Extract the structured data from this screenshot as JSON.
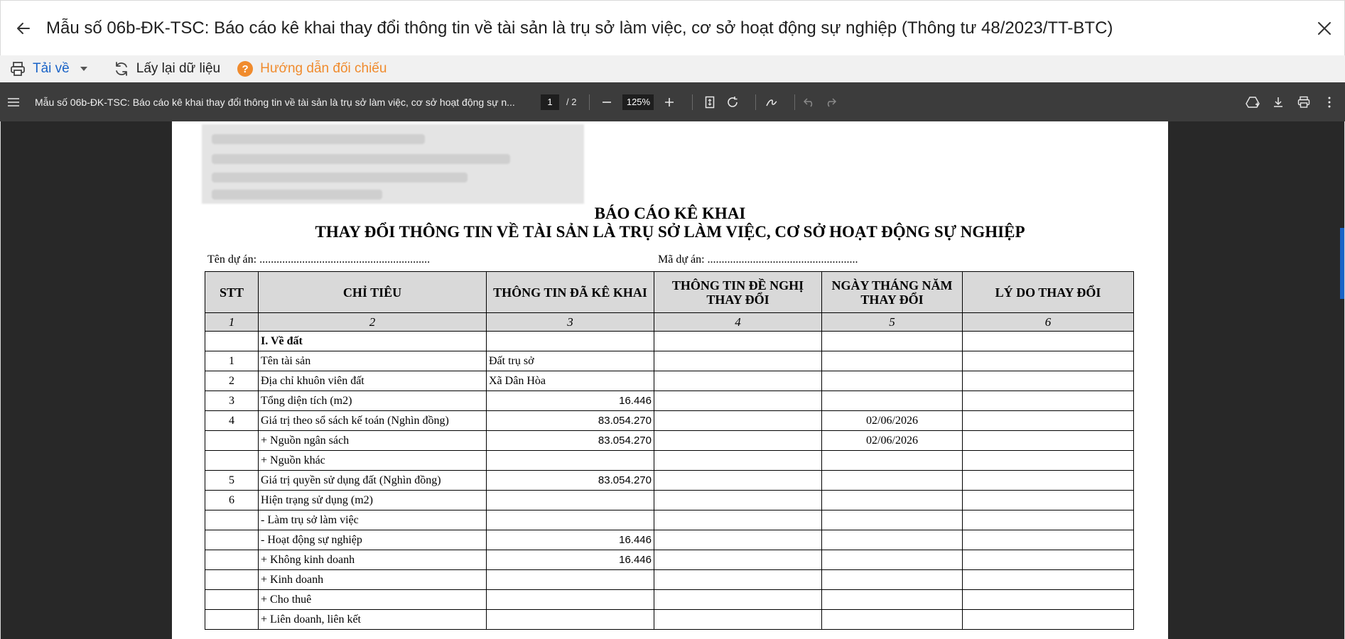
{
  "window": {
    "title": "Mẫu số 06b-ĐK-TSC: Báo cáo kê khai thay đổi thông tin về tài sản là trụ sở làm việc, cơ sở hoạt động sự nghiệp (Thông tư 48/2023/TT-BTC)"
  },
  "actions": {
    "download_label": "Tải về",
    "reload_label": "Lấy lại dữ liệu",
    "guide_label": "Hướng dẫn đối chiếu"
  },
  "pdf_toolbar": {
    "doc_title": "Mẫu số 06b-ĐK-TSC: Báo cáo kê khai thay đổi thông tin về tài sản là trụ sở làm việc, cơ sở hoạt động sự n...",
    "current_page": "1",
    "page_total": "/  2",
    "zoom": "125%"
  },
  "report": {
    "title_line1": "BÁO CÁO KÊ KHAI",
    "title_line2": "THAY ĐỔI THÔNG TIN VỀ TÀI SẢN LÀ TRỤ SỞ LÀM VIỆC, CƠ SỞ HOẠT ĐỘNG SỰ NGHIỆP",
    "project_name_field": "Tên dự án: ............................................................",
    "project_code_field": "Mã dự án: .....................................................",
    "headers": [
      "STT",
      "CHỈ TIÊU",
      "THÔNG TIN ĐÃ KÊ KHAI",
      "THÔNG TIN ĐỀ NGHỊ THAY ĐỔI",
      "NGÀY THÁNG NĂM THAY ĐỔI",
      "LÝ DO THAY ĐỔI"
    ],
    "column_numbers": [
      "1",
      "2",
      "3",
      "4",
      "5",
      "6"
    ],
    "rows": [
      {
        "stt": "",
        "label": "I. Về đất",
        "declared": "",
        "proposed": "",
        "date": "",
        "reason": ""
      },
      {
        "stt": "1",
        "label": "Tên tài sản",
        "declared": "Đất trụ sở",
        "proposed": "",
        "date": "",
        "reason": ""
      },
      {
        "stt": "2",
        "label": "Địa chỉ khuôn viên đất",
        "declared": "Xã Dân Hòa",
        "proposed": "",
        "date": "",
        "reason": ""
      },
      {
        "stt": "3",
        "label": "Tổng diện tích (m2)",
        "declared": "16.446",
        "proposed": "",
        "date": "",
        "reason": ""
      },
      {
        "stt": "4",
        "label": "Giá trị theo sổ sách kế toán (Nghìn đồng)",
        "declared": "83.054.270",
        "proposed": "",
        "date": "02/06/2026",
        "reason": ""
      },
      {
        "stt": "",
        "label": "+ Nguồn ngân sách",
        "declared": "83.054.270",
        "proposed": "",
        "date": "02/06/2026",
        "reason": ""
      },
      {
        "stt": "",
        "label": "+ Nguồn khác",
        "declared": "",
        "proposed": "",
        "date": "",
        "reason": ""
      },
      {
        "stt": "5",
        "label": "Giá trị quyền sử dụng đất (Nghìn đồng)",
        "declared": "83.054.270",
        "proposed": "",
        "date": "",
        "reason": ""
      },
      {
        "stt": "6",
        "label": "Hiện trạng sử dụng (m2)",
        "declared": "",
        "proposed": "",
        "date": "",
        "reason": ""
      },
      {
        "stt": "",
        "label": "- Làm trụ sở làm việc",
        "declared": "",
        "proposed": "",
        "date": "",
        "reason": ""
      },
      {
        "stt": "",
        "label": "- Hoạt động sự nghiệp",
        "declared": "16.446",
        "proposed": "",
        "date": "",
        "reason": ""
      },
      {
        "stt": "",
        "label": "+ Không kinh doanh",
        "declared": "16.446",
        "proposed": "",
        "date": "",
        "reason": ""
      },
      {
        "stt": "",
        "label": "+ Kinh doanh",
        "declared": "",
        "proposed": "",
        "date": "",
        "reason": ""
      },
      {
        "stt": "",
        "label": "+ Cho thuê",
        "declared": "",
        "proposed": "",
        "date": "",
        "reason": ""
      },
      {
        "stt": "",
        "label": "+ Liên doanh, liên kết",
        "declared": "",
        "proposed": "",
        "date": "",
        "reason": ""
      }
    ]
  },
  "icons": {
    "back": "arrow-left-icon",
    "close": "close-icon",
    "printer": "printer-icon",
    "reload": "refresh-icon",
    "help": "question-circle-icon"
  },
  "colors": {
    "accent_blue": "#1a63c7",
    "guide_orange": "#f08b2d",
    "pdf_toolbar_bg": "#3c3c3c",
    "viewer_bg": "#282828",
    "table_header_bg": "#d9d9d9"
  }
}
